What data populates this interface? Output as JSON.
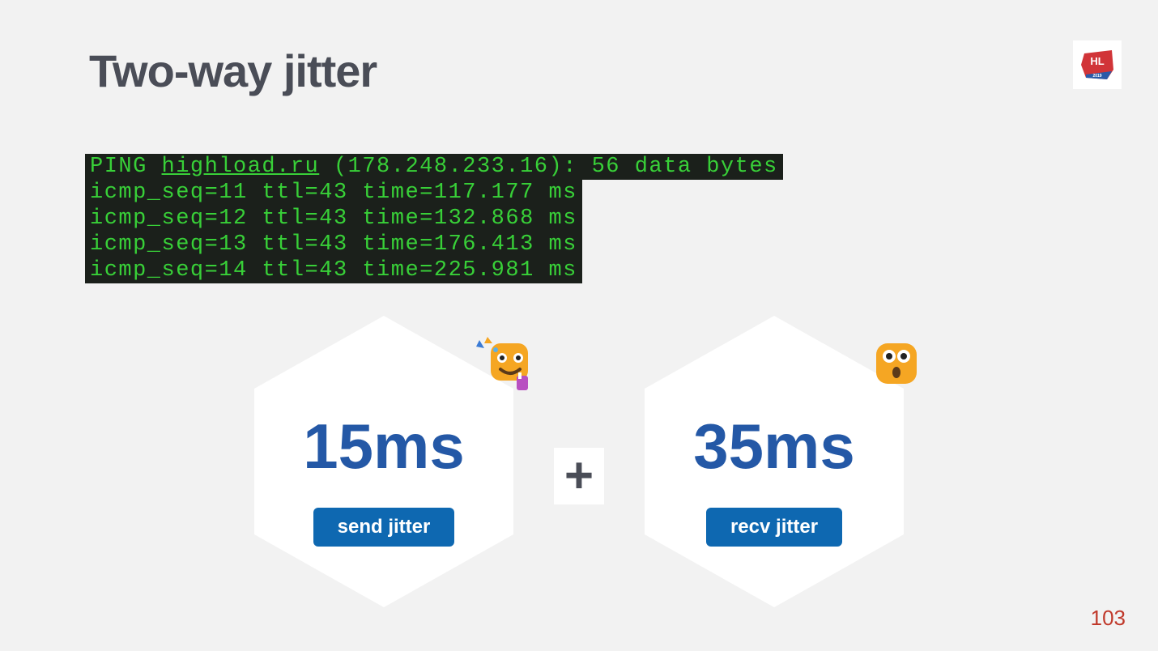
{
  "title": "Two-way jitter",
  "logo": {
    "text_top": "HL",
    "text_bottom": "2019"
  },
  "terminal": {
    "ping_prefix": "PING ",
    "host": "highload.ru",
    "ping_suffix": " (178.248.233.16): 56 data bytes",
    "lines": [
      "icmp_seq=11 ttl=43 time=117.177 ms",
      "icmp_seq=12 ttl=43 time=132.868 ms",
      "icmp_seq=13 ttl=43 time=176.413 ms",
      "icmp_seq=14 ttl=43 time=225.981 ms"
    ]
  },
  "plus": "+",
  "cards": [
    {
      "value": "15ms",
      "label": "send jitter",
      "emoji": "party"
    },
    {
      "value": "35ms",
      "label": "recv jitter",
      "emoji": "surprised"
    }
  ],
  "page_number": "103"
}
